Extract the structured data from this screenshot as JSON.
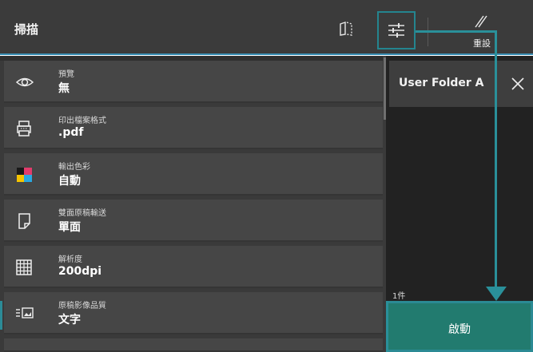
{
  "header": {
    "title": "掃描",
    "reset_label": "重設"
  },
  "settings": [
    {
      "label": "預覽",
      "value": "無",
      "icon": "eye-icon"
    },
    {
      "label": "印出檔案格式",
      "value": ".pdf",
      "icon": "printer-icon"
    },
    {
      "label": "輸出色彩",
      "value": "自動",
      "icon": "color-icon"
    },
    {
      "label": "雙面原稿輸送",
      "value": "單面",
      "icon": "document-icon"
    },
    {
      "label": "解析度",
      "value": "200dpi",
      "icon": "grid-icon"
    },
    {
      "label": "原稿影像品質",
      "value": "文字",
      "icon": "image-quality-icon"
    }
  ],
  "destination": {
    "folder_name": "User Folder A",
    "count": "1件"
  },
  "start_label": "啟動",
  "colors": {
    "header_bg": "#3b3b3b",
    "accent_teal": "#24858f",
    "start_green": "#227b6f",
    "header_line": "#3a8fb5"
  }
}
